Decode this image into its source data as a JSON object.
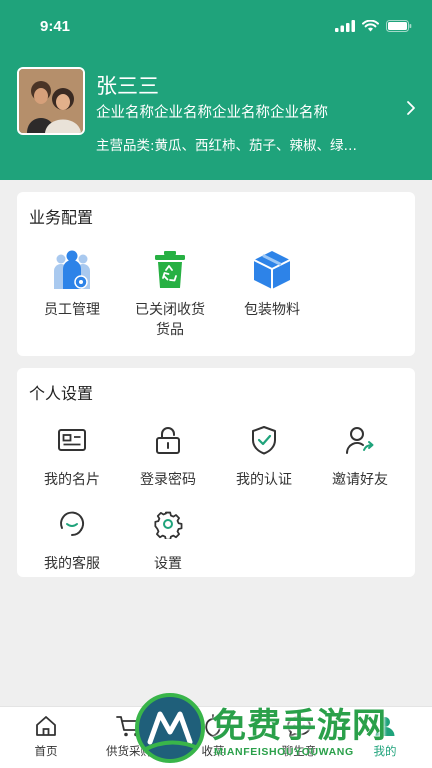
{
  "status_bar": {
    "time": "9:41"
  },
  "profile": {
    "name": "张三三",
    "company": "企业名称企业名称企业名称企业名称",
    "products": "主营品类:黄瓜、西红柿、茄子、辣椒、绿…"
  },
  "business_config": {
    "title": "业务配置",
    "items": [
      {
        "label": "员工管理",
        "icon": "staff-icon"
      },
      {
        "label": "已关闭收货货品",
        "icon": "recycle-bin-icon"
      },
      {
        "label": "包装物料",
        "icon": "package-box-icon"
      }
    ]
  },
  "personal_settings": {
    "title": "个人设置",
    "items": [
      {
        "label": "我的名片",
        "icon": "business-card-icon"
      },
      {
        "label": "登录密码",
        "icon": "lock-icon"
      },
      {
        "label": "我的认证",
        "icon": "shield-check-icon"
      },
      {
        "label": "邀请好友",
        "icon": "invite-user-icon"
      },
      {
        "label": "我的客服",
        "icon": "headset-icon"
      },
      {
        "label": "设置",
        "icon": "gear-icon"
      }
    ]
  },
  "tabbar": {
    "items": [
      {
        "label": "首页",
        "icon": "home-icon"
      },
      {
        "label": "供货采购",
        "icon": "cart-icon"
      },
      {
        "label": "收菜",
        "icon": "vegetable-icon"
      },
      {
        "label": "聊生意",
        "icon": "chat-icon"
      },
      {
        "label": "我的",
        "icon": "user-icon"
      }
    ],
    "active_index": 4
  },
  "watermark": {
    "text": "免费手游网",
    "sub": "MIANFEISHOUYOUWANG"
  },
  "colors": {
    "brand": "#1fa37b",
    "card_bg": "#ffffff",
    "page_bg": "#efefef",
    "accent_blue": "#2d83e8",
    "accent_green": "#27b043"
  }
}
